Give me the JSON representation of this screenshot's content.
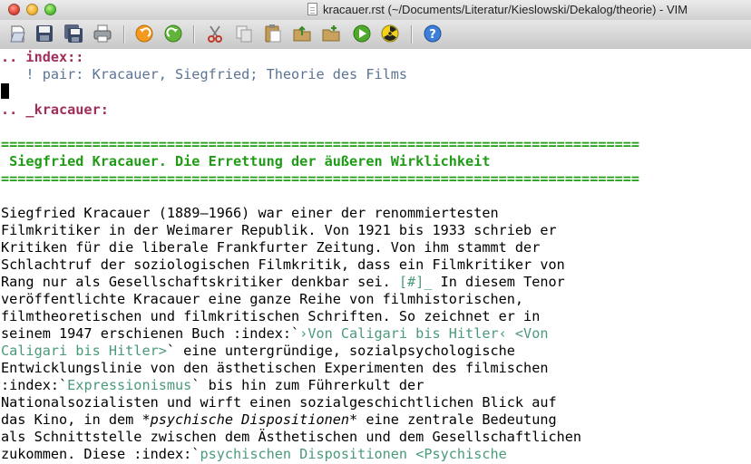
{
  "window": {
    "title": "kracauer.rst (~/Documents/Literatur/Kieslowski/Dekalog/theorie) - VIM"
  },
  "toolbar": {
    "buttons": [
      {
        "name": "open-button",
        "icon": "open-icon"
      },
      {
        "name": "save-button",
        "icon": "save-icon"
      },
      {
        "name": "save-all-button",
        "icon": "save-all-icon"
      },
      {
        "name": "print-button",
        "icon": "print-icon"
      },
      {
        "name": "undo-button",
        "icon": "undo-icon"
      },
      {
        "name": "redo-button",
        "icon": "redo-icon"
      },
      {
        "name": "cut-button",
        "icon": "scissors-icon"
      },
      {
        "name": "copy-button",
        "icon": "copy-icon"
      },
      {
        "name": "paste-button",
        "icon": "paste-icon"
      },
      {
        "name": "load-session-button",
        "icon": "load-session-icon"
      },
      {
        "name": "save-session-button",
        "icon": "save-session-icon"
      },
      {
        "name": "run-script-button",
        "icon": "play-icon"
      },
      {
        "name": "make-button",
        "icon": "radiation-icon"
      },
      {
        "name": "help-button",
        "icon": "help-icon"
      }
    ]
  },
  "editor": {
    "index_directive": ".. index::",
    "index_entry": "   ! pair: Kracauer, Siegfried; Theorie des Films",
    "target": ".. _kracauer:",
    "rule": "=============================================================================",
    "heading": " Siegfried Kracauer. Die Errettung der äußeren Wirklichkeit",
    "body": {
      "l1": "Siegfried Kracauer (1889–1966) war einer der renommiertesten",
      "l2": "Filmkritiker in der Weimarer Republik. Von 1921 bis 1933 schrieb er",
      "l3": "Kritiken für die liberale Frankfurter Zeitung. Von ihm stammt der",
      "l4": "Schlachtruf der soziologischen Filmkritik, dass ein Filmkritiker von",
      "l5a": "Rang nur als Gesellschaftskritiker denkbar sei. ",
      "l5b": "[#]_",
      "l5c": " In diesem Tenor",
      "l6": "veröffentlichte Kracauer eine ganze Reihe von filmhistorischen,",
      "l7": "filmtheoretischen und filmkritischen Schriften. So zeichnet er in",
      "l8a": "seinem 1947 erschienen Buch :index:`",
      "l8b": "›Von Caligari bis Hitler‹ <Von",
      "l9a": "Caligari bis Hitler>",
      "l9b": "` eine untergründige, sozialpsychologische",
      "l10": "Entwicklungslinie von den ästhetischen Experimenten des filmischen",
      "l11a": ":index:`",
      "l11b": "Expressionismus",
      "l11c": "` bis hin zum Führerkult der",
      "l12": "Nationalsozialisten und wirft einen sozialgeschichtlichen Blick auf",
      "l13a": "das Kino, in dem ",
      "l13b": "*psychische Dispositionen*",
      "l13c": " eine zentrale Bedeutung",
      "l14": "als Schnittstelle zwischen dem Ästhetischen und dem Gesellschaftlichen",
      "l15a": "zukommen. Diese :index:`",
      "l15b": "psychischen Dispositionen <Psychische"
    }
  }
}
